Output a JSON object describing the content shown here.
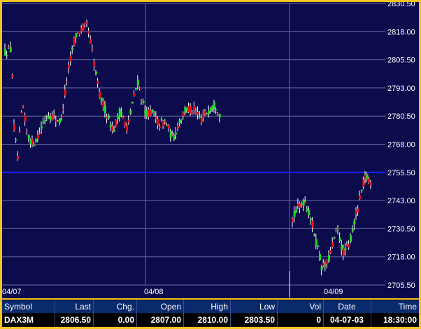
{
  "chart_data": {
    "type": "candlestick",
    "y_ticks": [
      "2830.50",
      "2818.00",
      "2805.50",
      "2793.00",
      "2780.50",
      "2768.00",
      "2755.50",
      "2743.00",
      "2730.50",
      "2718.00",
      "2705.50"
    ],
    "ylim": [
      2705.5,
      2830.5
    ],
    "x_labels": [
      "04/07",
      "04/08",
      "04/09"
    ],
    "grid": true,
    "reference_line": 2755.5,
    "colors": {
      "background": "#0c0c4c",
      "up": "#22dd22",
      "down": "#ee1111",
      "wick": "#ffffff",
      "grid": "#6a6aa0",
      "reference_line": "#2020ff",
      "axis_text": "#ffffff"
    },
    "segments": [
      {
        "x_label": "04/07",
        "anchors": [
          [
            0,
            2809
          ],
          [
            8,
            2810
          ],
          [
            9,
            2818
          ],
          [
            12,
            2778
          ],
          [
            18,
            2762
          ],
          [
            25,
            2786
          ],
          [
            32,
            2772
          ],
          [
            40,
            2768
          ],
          [
            50,
            2774
          ],
          [
            60,
            2781
          ],
          [
            70,
            2780
          ],
          [
            80,
            2778
          ],
          [
            90,
            2800
          ],
          [
            100,
            2816
          ],
          [
            110,
            2819
          ],
          [
            118,
            2821
          ],
          [
            128,
            2803
          ],
          [
            135,
            2790
          ],
          [
            145,
            2782
          ],
          [
            155,
            2774
          ],
          [
            165,
            2783
          ],
          [
            175,
            2775
          ],
          [
            182,
            2786
          ],
          [
            190,
            2796
          ],
          [
            200,
            2782
          ],
          [
            210,
            2782
          ],
          [
            220,
            2777
          ],
          [
            230,
            2778
          ],
          [
            240,
            2770
          ],
          [
            250,
            2779
          ],
          [
            260,
            2784
          ],
          [
            270,
            2783
          ],
          [
            280,
            2779
          ],
          [
            290,
            2783
          ],
          [
            300,
            2786
          ],
          [
            308,
            2781
          ]
        ]
      },
      {
        "x_label": "04/08",
        "anchors": []
      },
      {
        "x_label": "04/09",
        "anchors": [
          [
            0,
            2735
          ],
          [
            10,
            2741
          ],
          [
            18,
            2743
          ],
          [
            28,
            2733
          ],
          [
            36,
            2722
          ],
          [
            42,
            2713
          ],
          [
            50,
            2715
          ],
          [
            58,
            2724
          ],
          [
            64,
            2731
          ],
          [
            72,
            2720
          ],
          [
            80,
            2722
          ],
          [
            88,
            2733
          ],
          [
            92,
            2738
          ],
          [
            96,
            2743
          ],
          [
            100,
            2749
          ],
          [
            104,
            2753
          ],
          [
            108,
            2753
          ],
          [
            112,
            2751
          ]
        ]
      }
    ]
  },
  "quote": {
    "headers": [
      "Symbol",
      "Last",
      "Chg.",
      "Open",
      "High",
      "Low",
      "Vol",
      "Date",
      "Time"
    ],
    "row": {
      "symbol": "DAX3M",
      "last": "2806.50",
      "chg": "0.00",
      "open": "2807.00",
      "high": "2810.00",
      "low": "2803.50",
      "vol": "0",
      "date": "04-07-03",
      "time": "18:30:00"
    }
  }
}
